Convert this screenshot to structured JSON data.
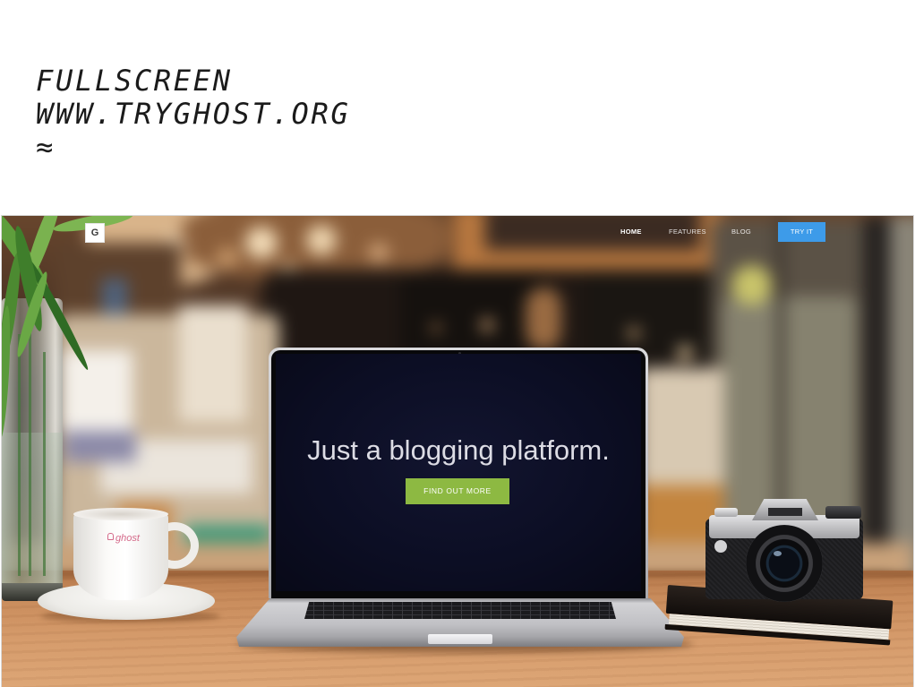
{
  "slide": {
    "title_lines": [
      "FULLSCREEN",
      "WWW.TRYGHOST.ORG",
      "≈"
    ]
  },
  "website": {
    "logo_letter": "G",
    "nav": [
      {
        "label": "HOME"
      },
      {
        "label": "FEATURES"
      },
      {
        "label": "BLOG"
      }
    ],
    "cta_label": "TRY IT",
    "hero": {
      "headline": "Just a blogging platform.",
      "button_label": "FIND OUT MORE"
    }
  },
  "photo": {
    "cup_logo_text": "ghost",
    "cup_logo_icon": "ghost-logo-icon"
  },
  "colors": {
    "cta_blue": "#3d9be9",
    "hero_button_green": "#8db942",
    "screen_background": "#0c0e24",
    "headline_text": "#dcdce4"
  }
}
